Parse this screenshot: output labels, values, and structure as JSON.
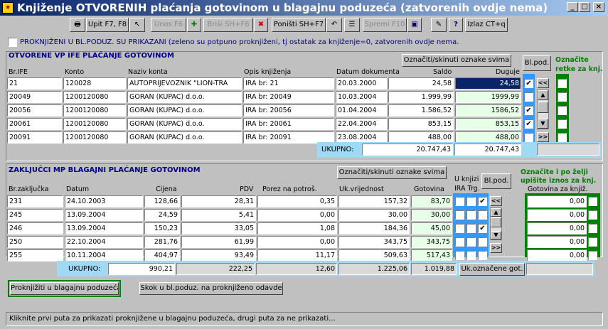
{
  "window": {
    "title": "Knjiženje OTVORENIH plaćanja gotovinom u blagajnu poduzeća (zatvorenih ovdje nema)"
  },
  "toolbar": {
    "upit": "Upit F7, F8",
    "unos": "Unos F6",
    "brisi": "Briši SH+F6",
    "ponisti": "Poništi SH+F7",
    "spremi": "Spremi F10",
    "izlaz": "Izlaz CT+q"
  },
  "filter": {
    "label": "PROKNJIŽENI U BL.PODUZ. SU PRIKAZANI (zeleno su potpuno proknjiženi, tj ostatak za knjiženje=0, zatvorenih ovdje nema."
  },
  "section1": {
    "title": "OTVORENE VP IFE PLAĆANJE GOTOVINOM",
    "toggle_btn": "Označiti/skinuti oznake svima",
    "blpod_btn": "Bl.pod.",
    "mark_label_1": "Označite",
    "mark_label_2": "retke za knj.",
    "headers": [
      "Br.IFE",
      "Konto",
      "Naziv konta",
      "Opis knjiženja",
      "Datum dokumenta",
      "Saldo",
      "Duguje"
    ],
    "rows": [
      {
        "br": "21",
        "konto": "120028",
        "naziv": "AUTOPRIJEVOZNIK \"LION-TRA",
        "opis": "IRA br: 21",
        "datum": "20.03.2000",
        "saldo": "24,58",
        "duguje": "24,58"
      },
      {
        "br": "20049",
        "konto": "1200120080",
        "naziv": "GORAN (KUPAC) d.o.o.",
        "opis": "IRA br: 20049",
        "datum": "10.03.2004",
        "saldo": "1.999,99",
        "duguje": "1999,99"
      },
      {
        "br": "20056",
        "konto": "1200120080",
        "naziv": "GORAN (KUPAC) d.o.o.",
        "opis": "IRA br: 20056",
        "datum": "01.04.2004",
        "saldo": "1.586,52",
        "duguje": "1586,52"
      },
      {
        "br": "20061",
        "konto": "1200120080",
        "naziv": "GORAN (KUPAC) d.o.o.",
        "opis": "IRA br: 20061",
        "datum": "22.04.2004",
        "saldo": "853,15",
        "duguje": "853,15"
      },
      {
        "br": "20091",
        "konto": "1200120080",
        "naziv": "GORAN (KUPAC) d.o.o.",
        "opis": "IRA br: 20091",
        "datum": "23.08.2004",
        "saldo": "488,00",
        "duguje": "488,00"
      }
    ],
    "checks": [
      "✔",
      "",
      "✔",
      "✔",
      ""
    ],
    "total_label": "UKUPNO:",
    "total_saldo": "20.747,43",
    "total_duguje": "20.747,43"
  },
  "section2": {
    "title": "ZAKLJUČCI MP BLAGAJNI PLAĆANJE GOTOVINOM",
    "toggle_btn": "Označiti/skinuti oznake svima",
    "blpod_btn": "Bl.pod.",
    "uknjizi": "U knjizi",
    "ira_trg": "IRA Trg.",
    "mark_label_1": "Označite i po želji",
    "mark_label_2": "upišite iznos za knj.",
    "headers": [
      "Br.zaključka",
      "Datum",
      "Cijena",
      "PDV",
      "Porez na potroš.",
      "Uk.vrijednost",
      "Gotovina",
      "Gotovina za knjiž."
    ],
    "rows": [
      {
        "br": "231",
        "datum": "24.10.2003",
        "cijena": "128,66",
        "pdv": "28,31",
        "porez": "0,35",
        "uk": "157,32",
        "got": "83,70",
        "gotk": "0,00"
      },
      {
        "br": "245",
        "datum": "13.09.2004",
        "cijena": "24,59",
        "pdv": "5,41",
        "porez": "0,00",
        "uk": "30,00",
        "got": "30,00",
        "gotk": "0,00"
      },
      {
        "br": "246",
        "datum": "13.09.2004",
        "cijena": "150,23",
        "pdv": "33,05",
        "porez": "1,08",
        "uk": "184,36",
        "got": "45,00",
        "gotk": "0,00"
      },
      {
        "br": "250",
        "datum": "22.10.2004",
        "cijena": "281,76",
        "pdv": "61,99",
        "porez": "0,00",
        "uk": "343,75",
        "got": "343,75",
        "gotk": "0,00"
      },
      {
        "br": "255",
        "datum": "10.11.2004",
        "cijena": "404,97",
        "pdv": "93,49",
        "porez": "11,17",
        "uk": "509,63",
        "got": "517,43",
        "gotk": "0,00"
      }
    ],
    "trg_checks": [
      "✔",
      "",
      "✔",
      "",
      ""
    ],
    "total_label": "UKUPNO:",
    "totals": {
      "cijena": "990,21",
      "pdv": "222,25",
      "porez": "12,60",
      "uk": "1.225,06",
      "got": "1.019,88"
    },
    "ukoznacene_btn": "Uk.označene got."
  },
  "actions": {
    "proknjiziti": "Proknjižiti u blagajnu poduzeća",
    "skok": "Skok u bl.poduz. na proknjiženo odavde"
  },
  "status": "Kliknite prvi puta za prikazati proknjižene u blagajnu poduzeća, drugi puta za ne prikazati..."
}
